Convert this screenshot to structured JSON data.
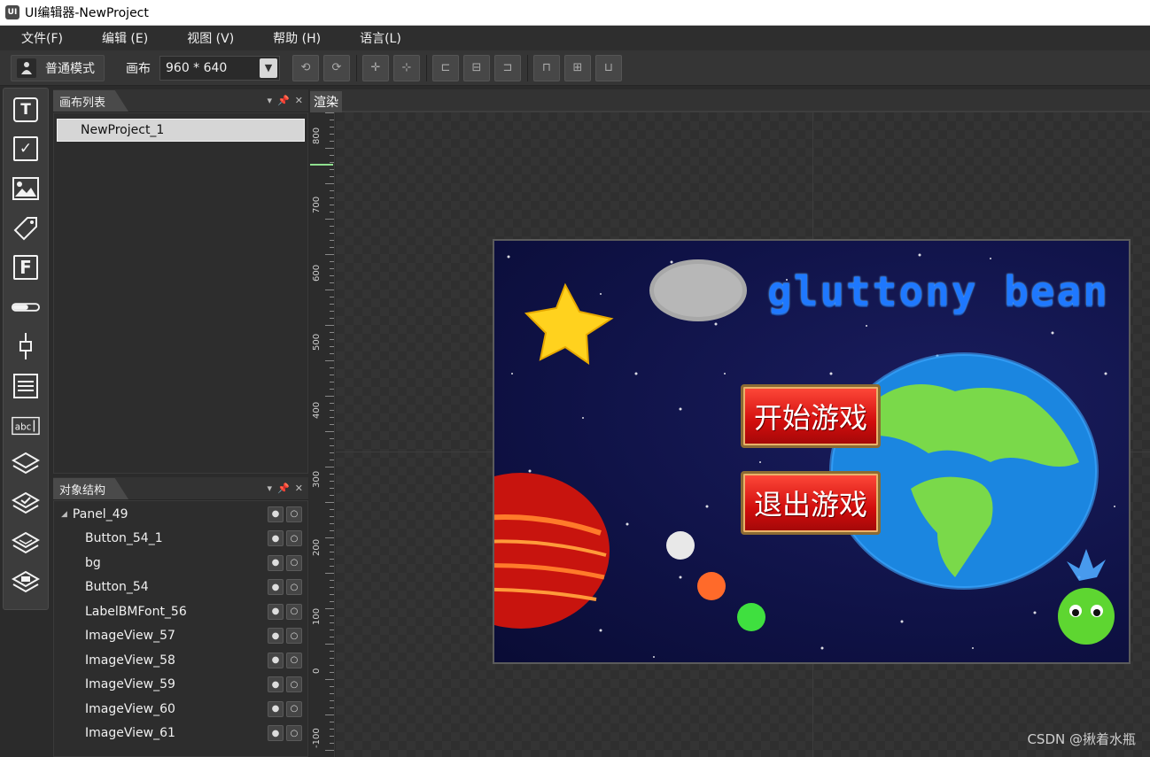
{
  "window": {
    "title": "UI编辑器-NewProject",
    "app_icon": "UI"
  },
  "menu": [
    "文件(F)",
    "编辑 (E)",
    "视图 (V)",
    "帮助 (H)",
    "语言(L)"
  ],
  "toolbar": {
    "mode_label": "普通模式",
    "canvas_label": "画布",
    "canvas_size": "960 * 640"
  },
  "tools": [
    "text-tool-icon",
    "checkbox-tool-icon",
    "image-tool-icon",
    "tag-tool-icon",
    "labelbmfont-tool-icon",
    "loadingbar-tool-icon",
    "slider-tool-icon",
    "listview-tool-icon",
    "textfield-tool-icon",
    "layer-tool-icon",
    "layer-check-tool-icon",
    "layer-stack-tool-icon",
    "layer-edit-tool-icon"
  ],
  "canvas_panel": {
    "title": "画布列表",
    "items": [
      "NewProject_1"
    ]
  },
  "object_panel": {
    "title": "对象结构",
    "root": "Panel_49",
    "children": [
      "Button_54_1",
      "bg",
      "Button_54",
      "LabelBMFont_56",
      "ImageView_57",
      "ImageView_58",
      "ImageView_59",
      "ImageView_60",
      "ImageView_61"
    ]
  },
  "render": {
    "tab_label": "渲染",
    "ruler_labels": [
      "800",
      "700",
      "600",
      "500",
      "400",
      "300",
      "200",
      "100",
      "0",
      "-100"
    ]
  },
  "game": {
    "title": "gluttony bean",
    "start_button": "开始游戏",
    "exit_button": "退出游戏"
  },
  "watermark": "CSDN @揪着水瓶"
}
